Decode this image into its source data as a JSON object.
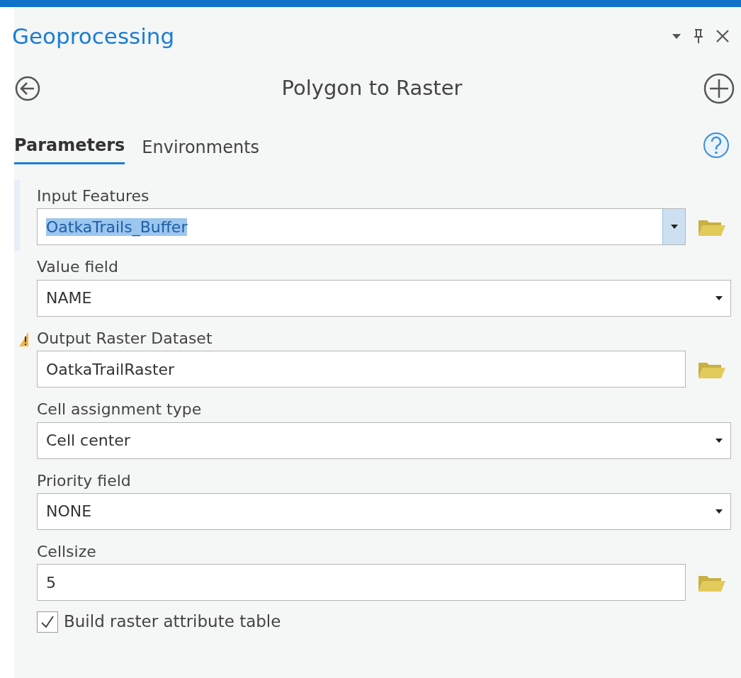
{
  "pane": {
    "title": "Geoprocessing"
  },
  "tool": {
    "title": "Polygon to Raster"
  },
  "tabs": [
    {
      "label": "Parameters",
      "selected": true
    },
    {
      "label": "Environments",
      "selected": false
    }
  ],
  "parameters": [
    {
      "label": "Input Features",
      "value": "OatkaTrails_Buffer",
      "kind": "combo",
      "browse": true,
      "warning": false,
      "selected": true,
      "highlighted": true
    },
    {
      "label": "Value field",
      "value": "NAME",
      "kind": "select",
      "browse": false,
      "warning": false,
      "selected": false,
      "highlighted": false
    },
    {
      "label": "Output Raster Dataset",
      "value": "OatkaTrailRaster",
      "kind": "text",
      "browse": true,
      "warning": true,
      "selected": false,
      "highlighted": false
    },
    {
      "label": "Cell assignment type",
      "value": "Cell center",
      "kind": "select",
      "browse": false,
      "warning": false,
      "selected": false,
      "highlighted": false
    },
    {
      "label": "Priority field",
      "value": "NONE",
      "kind": "select",
      "browse": false,
      "warning": false,
      "selected": false,
      "highlighted": false
    },
    {
      "label": "Cellsize",
      "value": "5",
      "kind": "text",
      "browse": true,
      "warning": false,
      "selected": false,
      "highlighted": false
    }
  ],
  "options": [
    {
      "label": "Build raster attribute table",
      "checked": true
    }
  ]
}
